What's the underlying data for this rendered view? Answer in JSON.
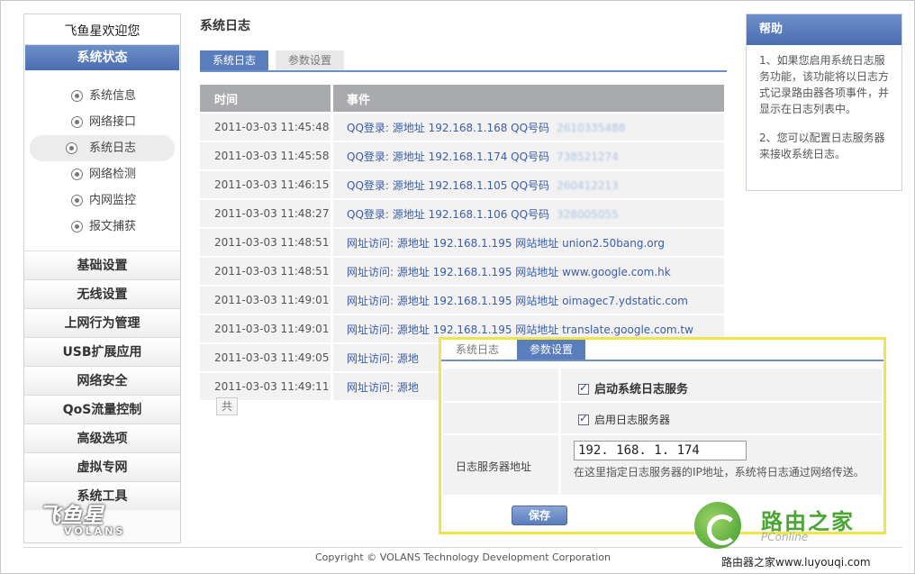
{
  "sidebar": {
    "welcome": "飞鱼星欢迎您",
    "active_section": "系统状态",
    "sub_items": [
      "系统信息",
      "网络接口",
      "系统日志",
      "网络检测",
      "内网监控",
      "报文捕获"
    ],
    "selected_sub_index": 2,
    "menu_items": [
      "基础设置",
      "无线设置",
      "上网行为管理",
      "USB扩展应用",
      "网络安全",
      "QoS流量控制",
      "高级选项",
      "虚拟专网",
      "系统工具"
    ],
    "logo": {
      "text": "飞鱼星",
      "sub": "VOLANS"
    }
  },
  "main": {
    "title": "系统日志",
    "tabs": [
      {
        "label": "系统日志",
        "active": true
      },
      {
        "label": "参数设置",
        "active": false
      }
    ],
    "table": {
      "headers": [
        "时间",
        "事件"
      ],
      "rows": [
        {
          "time": "2011-03-03 11:45:48",
          "event": "QQ登录:  源地址  192.168.1.168 QQ号码",
          "blur": "2610335488"
        },
        {
          "time": "2011-03-03 11:45:58",
          "event": "QQ登录:  源地址  192.168.1.174 QQ号码",
          "blur": "738521274"
        },
        {
          "time": "2011-03-03 11:46:15",
          "event": "QQ登录:  源地址  192.168.1.105 QQ号码",
          "blur": "260412213"
        },
        {
          "time": "2011-03-03 11:48:27",
          "event": "QQ登录:  源地址  192.168.1.106 QQ号码",
          "blur": "328005055"
        },
        {
          "time": "2011-03-03 11:48:51",
          "event": "网址访问:  源地址  192.168.1.195 网站地址  union2.50bang.org",
          "blur": ""
        },
        {
          "time": "2011-03-03 11:48:51",
          "event": "网址访问:  源地址  192.168.1.195 网站地址  www.google.com.hk",
          "blur": ""
        },
        {
          "time": "2011-03-03 11:49:01",
          "event": "网址访问:  源地址  192.168.1.195 网站地址  oimagec7.ydstatic.com",
          "blur": ""
        },
        {
          "time": "2011-03-03 11:49:01",
          "event": "网址访问:  源地址  192.168.1.195 网站地址  translate.google.com.tw",
          "blur": ""
        },
        {
          "time": "2011-03-03 11:49:05",
          "event": "网址访问:  源地",
          "blur": ""
        },
        {
          "time": "2011-03-03 11:49:11",
          "event": "网址访问:  源地",
          "blur": ""
        }
      ]
    },
    "pager_label": "共"
  },
  "help": {
    "title": "帮助",
    "paragraphs": [
      "1、如果您启用系统日志服务功能，该功能将以日志方式记录路由器各项事件，并显示在日志列表中。",
      "2、您可以配置日志服务器来接收系统日志。"
    ]
  },
  "overlay": {
    "tabs": [
      {
        "label": "系统日志",
        "active": false
      },
      {
        "label": "参数设置",
        "active": true
      }
    ],
    "enable_service_label": "启动系统日志服务",
    "enable_server_label": "启用日志服务器",
    "server_addr_label": "日志服务器地址",
    "server_addr_value": "192. 168. 1. 174",
    "server_addr_note": "在这里指定日志服务器的IP地址，系统将日志通过网络传送。",
    "save_label": "保存"
  },
  "footer": {
    "copyright": "Copyright © VOLANS Technology Development Corporation"
  },
  "watermark": {
    "title": "路由之家",
    "sub": "PConline",
    "url": "路由器之家www.luyouqi.com"
  },
  "colors": {
    "accent": "#5a7dbd",
    "highlight_border": "#f0e44a",
    "link": "#3a5ea8"
  }
}
